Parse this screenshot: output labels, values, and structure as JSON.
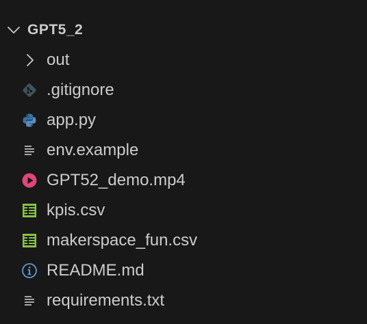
{
  "explorer": {
    "root": {
      "label": "GPT5_2",
      "expanded": true,
      "icon": "chevron-down-icon"
    },
    "items": [
      {
        "label": "out",
        "type": "folder",
        "icon": "chevron-right-icon"
      },
      {
        "label": ".gitignore",
        "type": "file",
        "icon": "git-icon",
        "color": "#41535b"
      },
      {
        "label": "app.py",
        "type": "file",
        "icon": "python-icon",
        "color": "#3572a5"
      },
      {
        "label": "env.example",
        "type": "file",
        "icon": "text-lines-icon",
        "color": "#cccccc"
      },
      {
        "label": "GPT52_demo.mp4",
        "type": "file",
        "icon": "video-play-icon",
        "color": "#e0467a"
      },
      {
        "label": "kpis.csv",
        "type": "file",
        "icon": "spreadsheet-icon",
        "color": "#89c343"
      },
      {
        "label": "makerspace_fun.csv",
        "type": "file",
        "icon": "spreadsheet-icon",
        "color": "#89c343"
      },
      {
        "label": "README.md",
        "type": "file",
        "icon": "info-icon",
        "color": "#5b9bd5"
      },
      {
        "label": "requirements.txt",
        "type": "file",
        "icon": "text-lines-icon",
        "color": "#cccccc"
      }
    ]
  }
}
